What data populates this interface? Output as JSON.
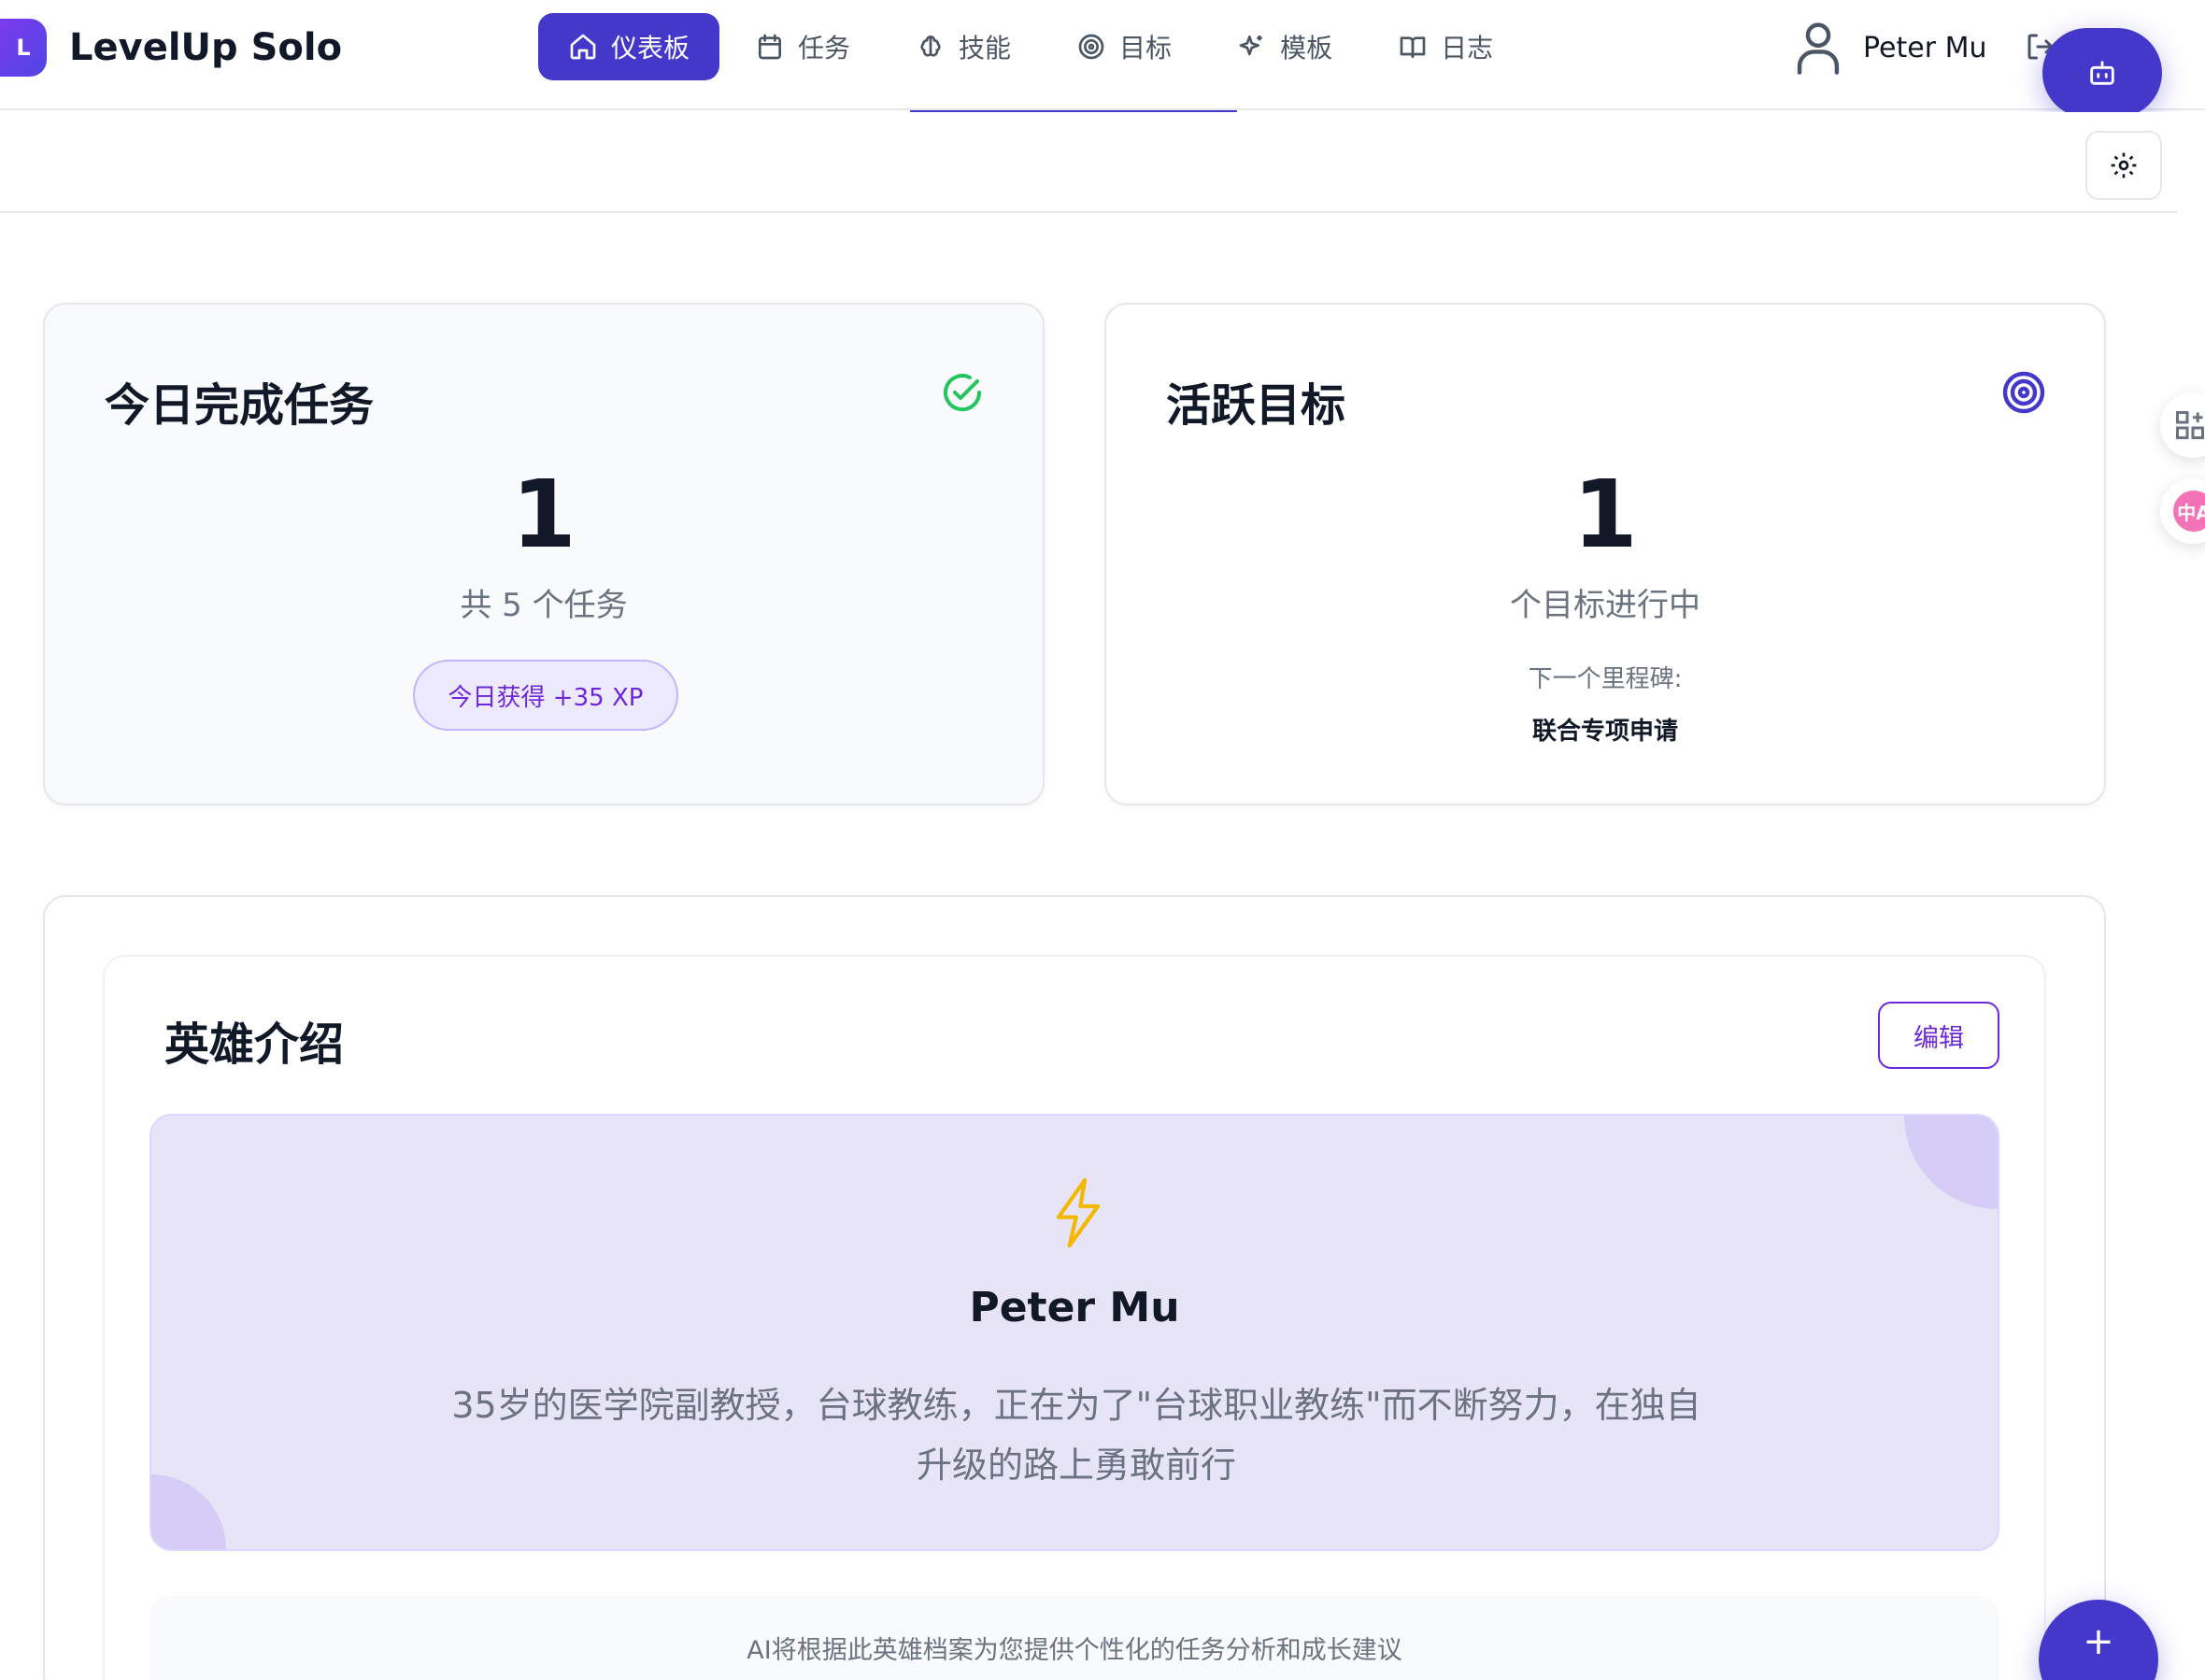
{
  "app": {
    "logo_letter": "L",
    "name": "LevelUp Solo"
  },
  "nav": {
    "items": [
      {
        "label": "仪表板",
        "icon": "home-icon",
        "active": true
      },
      {
        "label": "任务",
        "icon": "calendar-icon",
        "active": false
      },
      {
        "label": "技能",
        "icon": "brain-icon",
        "active": false
      },
      {
        "label": "目标",
        "icon": "target-icon",
        "active": false
      },
      {
        "label": "模板",
        "icon": "sparkles-icon",
        "active": false
      },
      {
        "label": "日志",
        "icon": "book-icon",
        "active": false
      }
    ]
  },
  "user": {
    "name": "Peter Mu"
  },
  "stats": {
    "tasks": {
      "title": "今日完成任务",
      "value": "1",
      "subtitle": "共 5 个任务",
      "xp_badge": "今日获得 +35 XP"
    },
    "goals": {
      "title": "活跃目标",
      "value": "1",
      "subtitle": "个目标进行中",
      "milestone_label": "下一个里程碑:",
      "milestone_value": "联合专项申请"
    }
  },
  "hero": {
    "section_title": "英雄介绍",
    "edit_label": "编辑",
    "name": "Peter Mu",
    "bio": "35岁的医学院副教授，台球教练，正在为了\"台球职业教练\"而不断努力，在独自升级的路上勇敢前行",
    "ai_note": "AI将根据此英雄档案为您提供个性化的任务分析和成长建议"
  },
  "fab": {
    "plus_label": "+"
  },
  "side_tools": {
    "translate_label": "中A"
  },
  "colors": {
    "primary": "#4338ca",
    "accent_purple": "#6d28d9",
    "success_green": "#22c55e",
    "banner_bg": "#e8e4f8",
    "bolt_yellow": "#f5b800"
  }
}
